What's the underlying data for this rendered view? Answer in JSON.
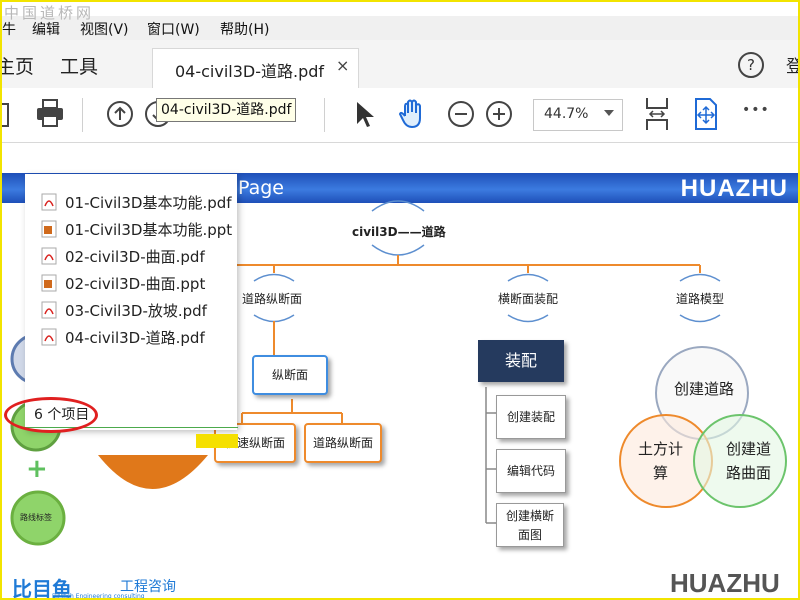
{
  "watermark": "中国道桥网",
  "menu": {
    "partial_left": "牛",
    "edit": "编辑",
    "view": "视图(V)",
    "window": "窗口(W)",
    "help": "帮助(H)"
  },
  "tabs": {
    "home_partial": "主页",
    "tools": "工具",
    "document": "04-civil3D-道路.pdf",
    "close": "×",
    "help_icon": "?",
    "signin_partial": "登"
  },
  "toolbar": {
    "zoom_value": "44.7%",
    "tooltip": "04-civil3D-道路.pdf",
    "more": "•••"
  },
  "document": {
    "banner_page": "Page",
    "banner_logo": "HUAZHU",
    "root_title": "civil3D——道路",
    "branch1": "道路纵断面",
    "branch2": "横断面装配",
    "branch3": "道路模型",
    "zongduanmian": "纵断面",
    "kuaisu": "快速纵断面",
    "daolu_zong": "道路纵断面",
    "zhuangpei": "装配",
    "create_assembly": "创建装配",
    "edit_code": "编辑代码",
    "create_section_1": "创建横断",
    "create_section_2": "面图",
    "venn_top": "创建道路",
    "venn_left_1": "土方计",
    "venn_left_2": "算",
    "venn_right_1": "创建道",
    "venn_right_2": "路曲面",
    "route_label": "路线标签",
    "plus": "+"
  },
  "popup": {
    "files": [
      {
        "name": "01-Civil3D基本功能.pdf",
        "type": "pdf"
      },
      {
        "name": "01-Civil3D基本功能.ppt",
        "type": "ppt"
      },
      {
        "name": "02-civil3D-曲面.pdf",
        "type": "pdf"
      },
      {
        "name": "02-civil3D-曲面.ppt",
        "type": "ppt"
      },
      {
        "name": "03-Civil3D-放坡.pdf",
        "type": "pdf"
      },
      {
        "name": "04-civil3D-道路.pdf",
        "type": "pdf"
      }
    ],
    "count": "6 个项目"
  },
  "footer": {
    "logo": "比目鱼",
    "sub": "工程咨询",
    "english": "BIMfish Engineering consulting",
    "brand": "HUAZHU"
  },
  "colors": {
    "banner": "#2a62cc",
    "accent_orange": "#ee8a2c",
    "highlight_red": "#e02020",
    "pdf_red": "#d9231f",
    "ppt_orange": "#d06a1c"
  }
}
